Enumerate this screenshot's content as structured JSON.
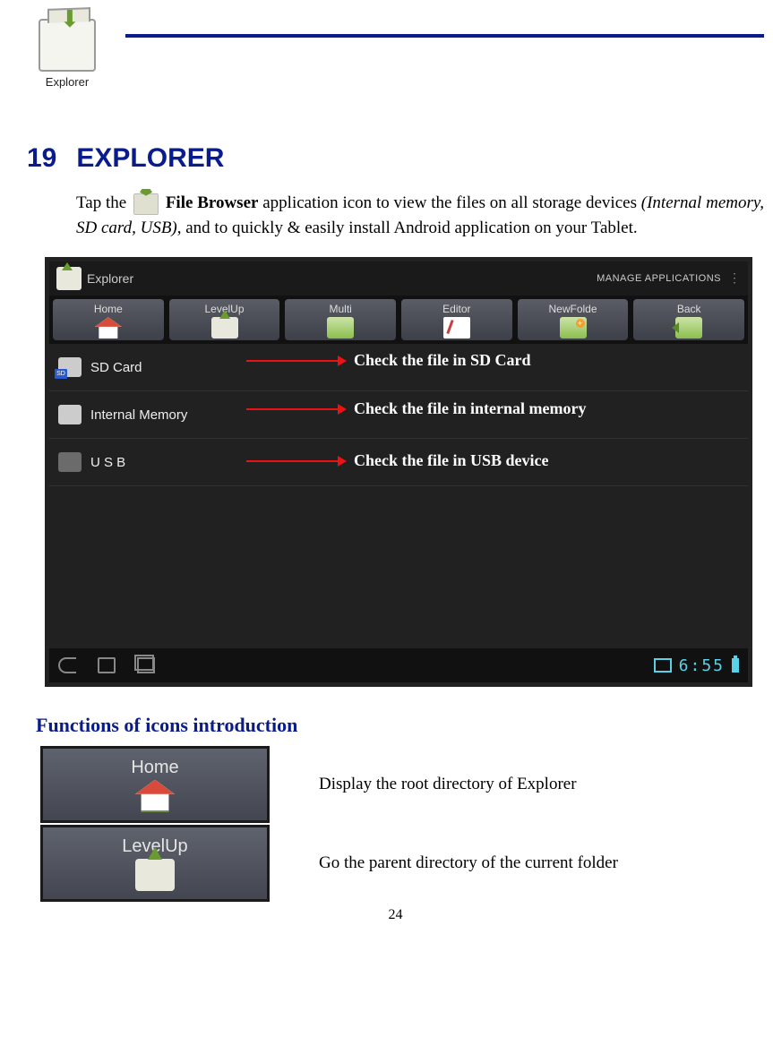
{
  "header": {
    "icon_label": "Explorer"
  },
  "heading": {
    "number": "19",
    "title": "EXPLORER"
  },
  "intro": {
    "lead": "Tap the ",
    "bold1": "File Browser",
    "mid": " application icon to view the files on all storage devices ",
    "italic": "(Internal memory, SD card, USB)",
    "tail": ", and to quickly & easily install Android application on your Tablet."
  },
  "screenshot": {
    "title": "Explorer",
    "manage": "MANAGE APPLICATIONS",
    "toolbar": {
      "home": "Home",
      "levelup": "LevelUp",
      "multi": "Multi",
      "editor": "Editor",
      "newfolder": "NewFolde",
      "back": "Back"
    },
    "rows": {
      "sdcard": "SD Card",
      "internal": "Internal Memory",
      "usb": "U S B",
      "sd_badge": "SD"
    },
    "annot": {
      "sd": "Check the file in SD Card",
      "internal": "Check the file in internal memory",
      "usb": "Check the file in USB device"
    },
    "time": "6:55"
  },
  "functions": {
    "heading": "Functions of icons introduction",
    "home": {
      "label": "Home",
      "desc": "Display the root directory of Explorer"
    },
    "levelup": {
      "label": "LevelUp",
      "desc": "Go the parent directory of the current folder"
    }
  },
  "page_number": "24"
}
